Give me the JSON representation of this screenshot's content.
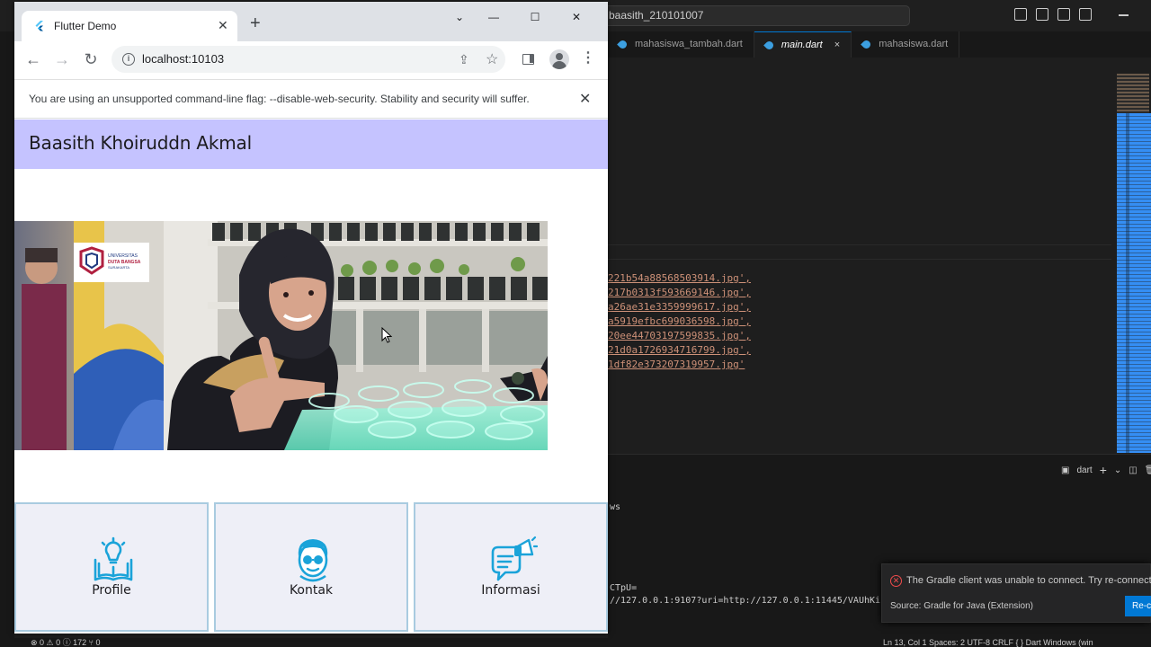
{
  "vscode": {
    "search_text": "baasith_210101007",
    "tabs": [
      {
        "label": "mahasiswa_tambah.dart",
        "active": false
      },
      {
        "label": "main.dart",
        "active": true
      },
      {
        "label": "mahasiswa.dart",
        "active": false
      }
    ],
    "tab_close": "×",
    "code_lines": [
      "221b54a88568503914.jpg',",
      "217b0313f593669146.jpg',",
      "a26ae31e3359999617.jpg',",
      "a5919efbc699036598.jpg',",
      "20ee44703197599835.jpg',",
      "21d0a1726934716799.jpg',",
      "1df82e373207319957.jpg'"
    ],
    "panel_label": "dart",
    "terminal_line1": "ws",
    "terminal_line2": "CTpU=",
    "terminal_line3": "//127.0.0.1:9107?uri=http://127.0.0.1:11445/VAUhKi",
    "status_left": "⊗ 0 ⚠ 0 ⓘ 172   ⑂ 0",
    "status_right": "Ln 13, Col 1    Spaces: 2    UTF-8    CRLF    { } Dart    Windows (win",
    "notification": {
      "message": "The Gradle client was unable to connect. Try re-connectin",
      "source": "Source: Gradle for Java (Extension)",
      "button": "Re-c"
    }
  },
  "chrome": {
    "tab_title": "Flutter Demo",
    "tab_close": "✕",
    "new_tab": "+",
    "window_controls": {
      "minimize": "—",
      "maximize": "☐",
      "close": "✕"
    },
    "url": "localhost:10103",
    "infobar_message": "You are using an unsupported command-line flag: --disable-web-security. Stability and security will suffer.",
    "infobar_close": "✕"
  },
  "app": {
    "title": "Baasith Khoiruddn Akmal",
    "photo_logo_lines": [
      "UNIVERSITAS",
      "DUTA BANGSA",
      "SURAKARTA"
    ],
    "cards": [
      {
        "label": "Profile",
        "icon": "book-lightbulb-icon"
      },
      {
        "label": "Kontak",
        "icon": "person-glasses-icon"
      },
      {
        "label": "Informasi",
        "icon": "megaphone-chat-icon"
      }
    ]
  },
  "colors": {
    "appbar": "#c5c3ff",
    "card_bg": "#eeeff7",
    "card_border": "#a9cbe0",
    "icon_blue": "#1aa3d9"
  }
}
